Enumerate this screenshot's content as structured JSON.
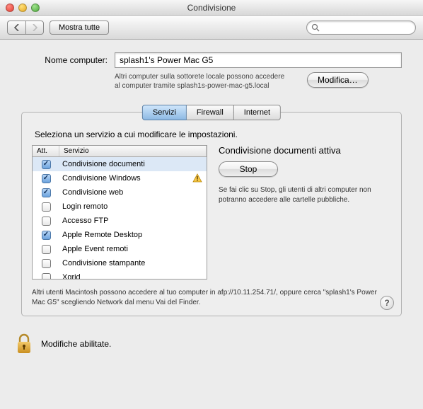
{
  "window": {
    "title": "Condivisione"
  },
  "toolbar": {
    "show_all": "Mostra tutte",
    "search_placeholder": ""
  },
  "computer_name": {
    "label": "Nome computer:",
    "value": "splash1's Power Mac G5",
    "hint": "Altri computer sulla sottorete locale possono accedere al computer tramite splash1s-power-mac-g5.local",
    "edit_button": "Modifica…"
  },
  "tabs": {
    "items": [
      {
        "label": "Servizi"
      },
      {
        "label": "Firewall"
      },
      {
        "label": "Internet"
      }
    ]
  },
  "instruction": "Seleziona un servizio a cui modificare le impostazioni.",
  "table": {
    "columns": {
      "active": "Att.",
      "service": "Servizio"
    },
    "rows": [
      {
        "on": true,
        "label": "Condivisione documenti",
        "selected": true,
        "warn": false
      },
      {
        "on": true,
        "label": "Condivisione Windows",
        "selected": false,
        "warn": true
      },
      {
        "on": true,
        "label": "Condivisione web",
        "selected": false,
        "warn": false
      },
      {
        "on": false,
        "label": "Login remoto",
        "selected": false,
        "warn": false
      },
      {
        "on": false,
        "label": "Accesso FTP",
        "selected": false,
        "warn": false
      },
      {
        "on": true,
        "label": "Apple Remote Desktop",
        "selected": false,
        "warn": false
      },
      {
        "on": false,
        "label": "Apple Event remoti",
        "selected": false,
        "warn": false
      },
      {
        "on": false,
        "label": "Condivisione stampante",
        "selected": false,
        "warn": false
      },
      {
        "on": false,
        "label": "Xgrid",
        "selected": false,
        "warn": false
      }
    ]
  },
  "detail": {
    "title": "Condivisione documenti attiva",
    "stop_button": "Stop",
    "description": "Se fai clic su Stop, gli utenti di altri computer non potranno accedere alle cartelle pubbliche."
  },
  "footnote": "Altri utenti Macintosh possono accedere al tuo computer in afp://10.11.254.71/, oppure cerca \"splash1's Power Mac G5\" scegliendo Network dal menu Vai del Finder.",
  "help": "?",
  "lock": {
    "text": "Modifiche abilitate."
  }
}
